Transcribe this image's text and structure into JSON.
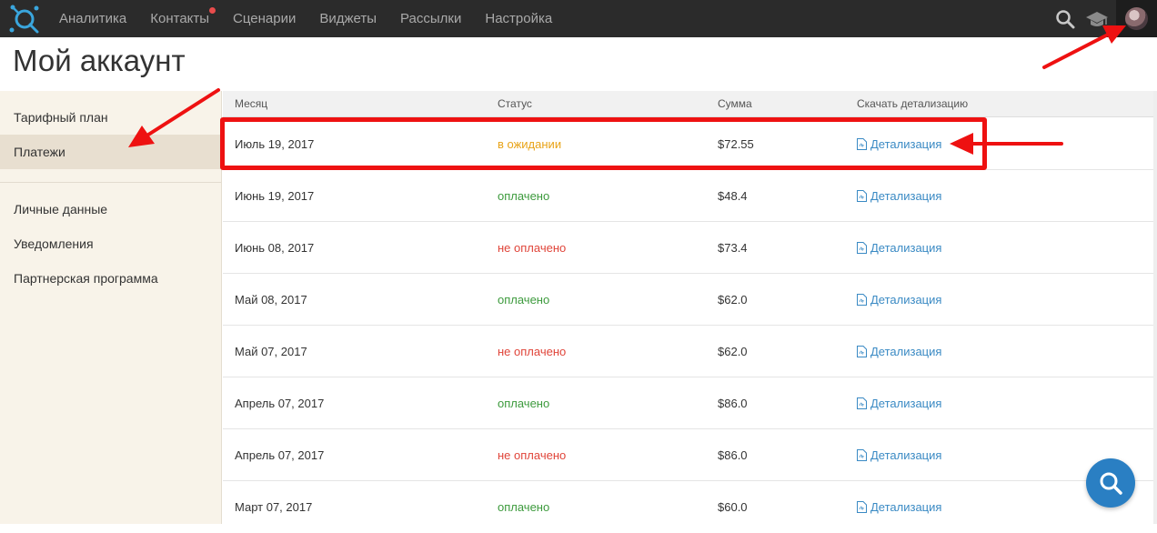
{
  "nav": {
    "items": [
      {
        "label": "Аналитика",
        "badge": false
      },
      {
        "label": "Контакты",
        "badge": true
      },
      {
        "label": "Сценарии",
        "badge": false
      },
      {
        "label": "Виджеты",
        "badge": false
      },
      {
        "label": "Рассылки",
        "badge": false
      },
      {
        "label": "Настройка",
        "badge": false
      }
    ],
    "icons": [
      "logo-icon",
      "search-icon",
      "graduation-cap-icon",
      "avatar"
    ]
  },
  "page": {
    "title": "Мой аккаунт"
  },
  "sidebar": {
    "items": [
      {
        "label": "Тарифный план",
        "active": false
      },
      {
        "label": "Платежи",
        "active": true
      },
      {
        "label": "Личные данные",
        "active": false
      },
      {
        "label": "Уведомления",
        "active": false
      },
      {
        "label": "Партнерская программа",
        "active": false
      }
    ]
  },
  "table": {
    "headers": [
      "Месяц",
      "Статус",
      "Сумма",
      "Скачать детализацию"
    ],
    "rows": [
      {
        "month": "Июль 19, 2017",
        "status": "в ожидании",
        "status_kind": "pending",
        "amount": "$72.55",
        "link": "Детализация"
      },
      {
        "month": "Июнь 19, 2017",
        "status": "оплачено",
        "status_kind": "paid",
        "amount": "$48.4",
        "link": "Детализация"
      },
      {
        "month": "Июнь 08, 2017",
        "status": "не оплачено",
        "status_kind": "unpaid",
        "amount": "$73.4",
        "link": "Детализация"
      },
      {
        "month": "Май 08, 2017",
        "status": "оплачено",
        "status_kind": "paid",
        "amount": "$62.0",
        "link": "Детализация"
      },
      {
        "month": "Май 07, 2017",
        "status": "не оплачено",
        "status_kind": "unpaid",
        "amount": "$62.0",
        "link": "Детализация"
      },
      {
        "month": "Апрель 07, 2017",
        "status": "оплачено",
        "status_kind": "paid",
        "amount": "$86.0",
        "link": "Детализация"
      },
      {
        "month": "Апрель 07, 2017",
        "status": "не оплачено",
        "status_kind": "unpaid",
        "amount": "$86.0",
        "link": "Детализация"
      },
      {
        "month": "Март 07, 2017",
        "status": "оплачено",
        "status_kind": "paid",
        "amount": "$60.0",
        "link": "Детализация"
      }
    ]
  },
  "colors": {
    "topbar": "#2b2b2b",
    "sidebar": "#f8f3e9",
    "pending": "#e8a317",
    "paid": "#3c9a3c",
    "unpaid": "#e0453a",
    "link": "#3a8ac4",
    "annotation": "#ee1111",
    "help_button": "#2a7fc3"
  }
}
